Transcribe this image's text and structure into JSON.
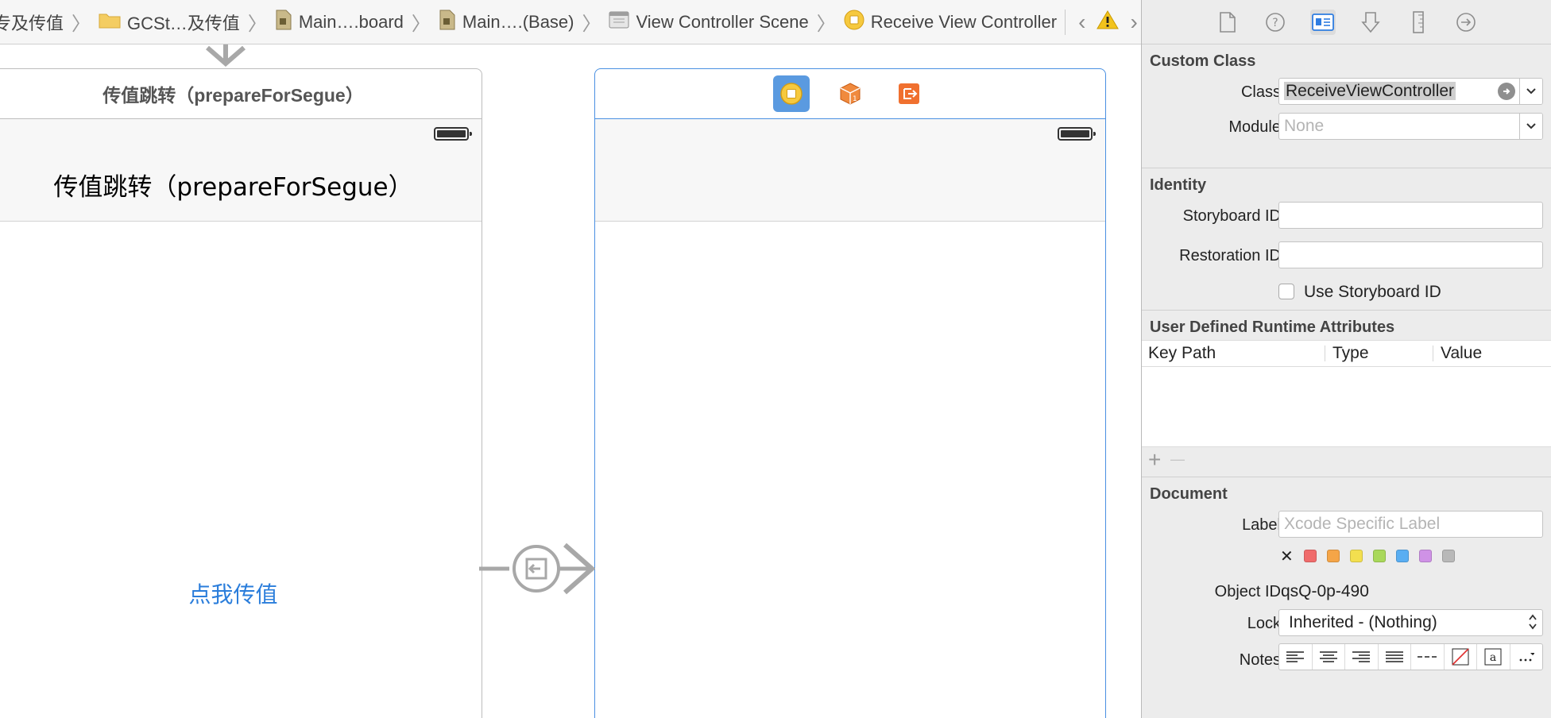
{
  "breadcrumb": {
    "items": [
      {
        "label": "专及传值",
        "icon": "none"
      },
      {
        "label": "GCSt…及传值",
        "icon": "folder-icon"
      },
      {
        "label": "Main….board",
        "icon": "storyboard-file-icon"
      },
      {
        "label": "Main….(Base)",
        "icon": "storyboard-file-icon"
      },
      {
        "label": "View Controller Scene",
        "icon": "scene-icon"
      },
      {
        "label": "Receive View Controller",
        "icon": "view-controller-icon"
      }
    ],
    "separator": "〉",
    "back": "‹",
    "forward": "›"
  },
  "canvas": {
    "left_scene": {
      "title": "传值跳转（prepareForSegue）",
      "nav_title": "传值跳转（prepareForSegue）",
      "button_label": "点我传值"
    },
    "right_scene": {
      "dock_icons": [
        "view-controller-icon",
        "first-responder-icon",
        "exit-icon"
      ]
    }
  },
  "inspector": {
    "tabs": [
      "file-inspector-icon",
      "quick-help-icon",
      "identity-inspector-icon",
      "attributes-inspector-icon",
      "size-inspector-icon",
      "connections-inspector-icon"
    ],
    "custom_class": {
      "title": "Custom Class",
      "class_label": "Class",
      "class_value": "ReceiveViewController",
      "module_label": "Module",
      "module_placeholder": "None"
    },
    "identity": {
      "title": "Identity",
      "storyboard_id_label": "Storyboard ID",
      "storyboard_id_value": "",
      "restoration_id_label": "Restoration ID",
      "restoration_id_value": "",
      "use_storyboard_id_label": "Use Storyboard ID"
    },
    "runtime_attributes": {
      "title": "User Defined Runtime Attributes",
      "columns": [
        "Key Path",
        "Type",
        "Value"
      ],
      "add": "+",
      "remove": "—"
    },
    "document": {
      "title": "Document",
      "label_label": "Label",
      "label_placeholder": "Xcode Specific Label",
      "clear": "✕",
      "colors": [
        "#f06b6b",
        "#f5a547",
        "#f3df4f",
        "#a9d85a",
        "#59aef2",
        "#cf92e6",
        "#b8b8b8"
      ],
      "object_id_label": "Object ID",
      "object_id_value": "qsQ-0p-490",
      "lock_label": "Lock",
      "lock_value": "Inherited - (Nothing)",
      "notes_label": "Notes"
    }
  }
}
